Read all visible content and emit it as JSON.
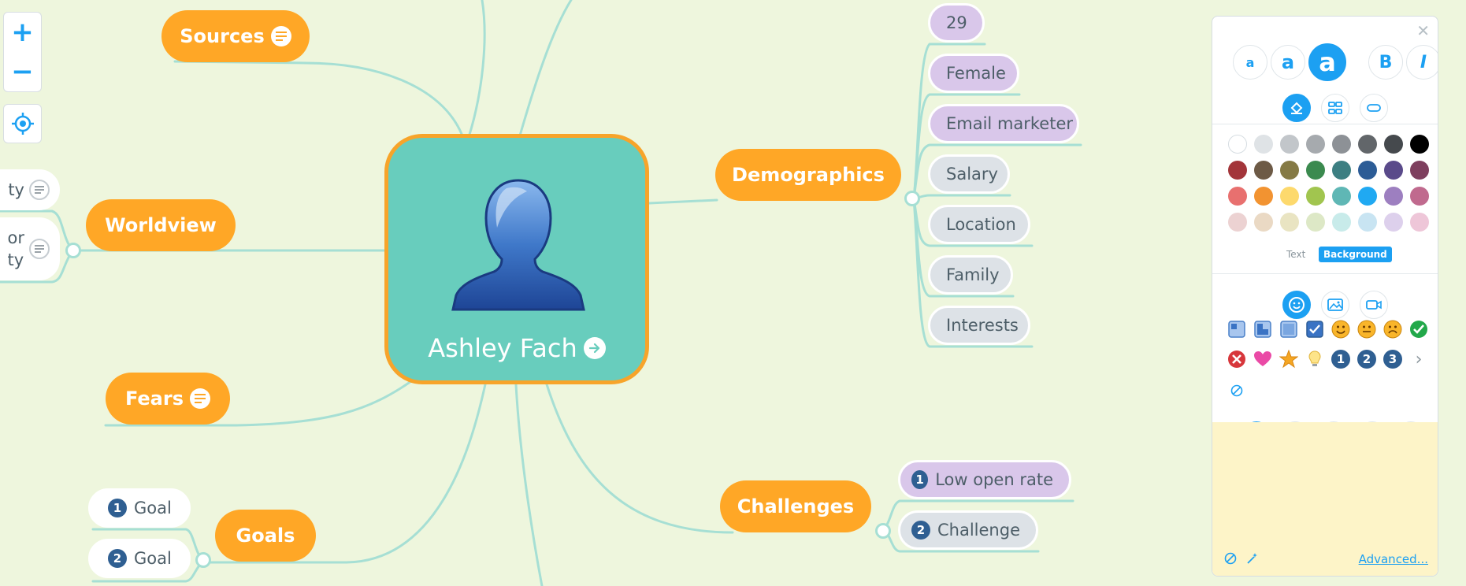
{
  "central": {
    "name": "Ashley Fach"
  },
  "branches": {
    "sources": "Sources",
    "worldview": "Worldview",
    "fears": "Fears",
    "goals": "Goals",
    "demographics": "Demographics",
    "challenges": "Challenges"
  },
  "demographics_items": [
    "29",
    "Female",
    "Email marketer",
    "Salary",
    "Location",
    "Family",
    "Interests"
  ],
  "challenges_items": [
    {
      "num": "1",
      "label": "Low open rate"
    },
    {
      "num": "2",
      "label": "Challenge"
    }
  ],
  "goals_items": [
    {
      "num": "1",
      "label": "Goal"
    },
    {
      "num": "2",
      "label": "Goal"
    }
  ],
  "worldview_items": [
    {
      "line1": "ty",
      "line2": ""
    },
    {
      "line1": "or",
      "line2": "ty"
    }
  ],
  "zoom": {
    "plus": "+",
    "minus": "−"
  },
  "panel": {
    "close": "✕",
    "font_sizes": [
      "a",
      "a",
      "a"
    ],
    "bold": "B",
    "italic": "I",
    "color_target_text": "Text",
    "color_target_background": "Background",
    "advanced": "Advanced...",
    "icon_numbers": [
      "1",
      "2",
      "3"
    ],
    "more": "›"
  },
  "colors": {
    "row1": [
      "#ffffff",
      "#dfe3e6",
      "#c2c6ca",
      "#a6aaae",
      "#8d9196",
      "#62666a",
      "#45494d",
      "#000000"
    ],
    "row2": [
      "#a3353a",
      "#6d5a46",
      "#857a45",
      "#3b8a4f",
      "#3d7f82",
      "#2c5c96",
      "#5a4a8a",
      "#7e3f5e"
    ],
    "row3": [
      "#e8706f",
      "#f29331",
      "#fdd96d",
      "#a1c54f",
      "#5fb7b5",
      "#20a9f2",
      "#9d7fc0",
      "#c06a8e"
    ],
    "row4": [
      "#ecd2d2",
      "#ead9c4",
      "#e9e4c2",
      "#dde8c6",
      "#c8ebea",
      "#c8e4f2",
      "#ddd0ec",
      "#eec6d8"
    ],
    "accent": "#1ca0f2",
    "branch": "#ffa726",
    "central_bg": "#68cdbd",
    "canvas_bg": "#eef6dd"
  }
}
